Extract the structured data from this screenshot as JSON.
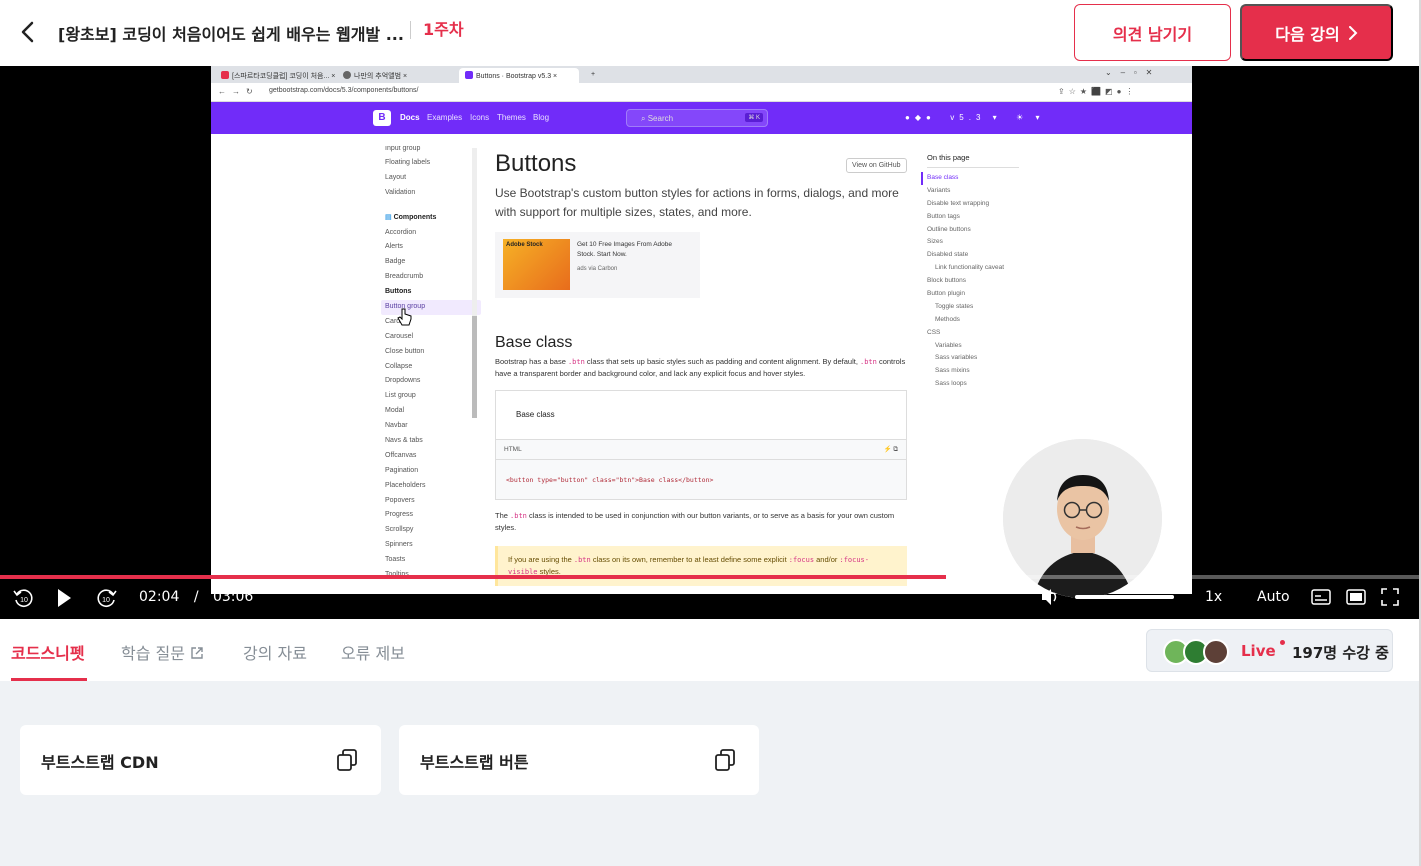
{
  "header": {
    "course_title": "[왕초보] 코딩이 처음이어도 쉽게 배우는 웹개발 ...",
    "week_label": "1주차",
    "opinion_button": "의견 남기기",
    "next_button": "다음 강의"
  },
  "video": {
    "browser_tabs": [
      "[스파르타코딩클럽] 코딩이 처음...",
      "나만의 추억앨범",
      "Buttons · Bootstrap v5.3"
    ],
    "url": "getbootstrap.com/docs/5.3/components/buttons/",
    "bs_nav": {
      "docs": "Docs",
      "examples": "Examples",
      "icons": "Icons",
      "themes": "Themes",
      "blog": "Blog",
      "search": "Search",
      "kbd": "⌘ K",
      "version": "v5.3"
    },
    "sidebar_items": [
      "Input group",
      "Floating labels",
      "Layout",
      "Validation"
    ],
    "sidebar_section": "Components",
    "component_items": [
      "Accordion",
      "Alerts",
      "Badge",
      "Breadcrumb",
      "Buttons",
      "Button group",
      "Card",
      "Carousel",
      "Close button",
      "Collapse",
      "Dropdowns",
      "List group",
      "Modal",
      "Navbar",
      "Navs & tabs",
      "Offcanvas",
      "Pagination",
      "Placeholders",
      "Popovers",
      "Progress",
      "Scrollspy",
      "Spinners",
      "Toasts",
      "Tooltips"
    ],
    "page_title": "Buttons",
    "lead": "Use Bootstrap's custom button styles for actions in forms, dialogs, and more with support for multiple sizes, states, and more.",
    "view_github": "View on GitHub",
    "ad_text": "Get 10 Free Images From Adobe Stock. Start Now.",
    "ad_brand": "Adobe Stock",
    "ad_via": "ads via Carbon",
    "section_title": "Base class",
    "base_p1": "Bootstrap has a base ",
    "base_code1": ".btn",
    "base_p2": " class that sets up basic styles such as padding and content alignment. By default, ",
    "base_code2": ".btn",
    "base_p3": " controls have a transparent border and background color, and lack any explicit focus and hover styles.",
    "example_label": "Base class",
    "html_label": "HTML",
    "code_snippet": "<button type=\"button\" class=\"btn\">Base class</button>",
    "intended_p1": "The ",
    "intended_code": ".btn",
    "intended_p2": " class is intended to be used in conjunction with our button variants, or to serve as a basis for your own custom styles.",
    "warn_p1": "If you are using the ",
    "warn_code1": ".btn",
    "warn_p2": " class on its own, remember to at least define some explicit ",
    "warn_code2": ":focus",
    "warn_p3": " and/or ",
    "warn_code3": ":focus-visible",
    "warn_p4": " styles.",
    "toc_title": "On this page",
    "toc_items": [
      "Base class",
      "Variants",
      "Disable text wrapping",
      "Button tags",
      "Outline buttons",
      "Sizes",
      "Disabled state",
      "Link functionality caveat",
      "Block buttons",
      "Button plugin",
      "Toggle states",
      "Methods",
      "CSS",
      "Variables",
      "Sass variables",
      "Sass mixins",
      "Sass loops"
    ]
  },
  "player": {
    "current_time": "02:04",
    "separator": "/",
    "total_time": "03:06",
    "progress_fraction": 0.666,
    "volume_fraction": 1.0,
    "speed": "1x",
    "quality": "Auto",
    "rewind_label": "10",
    "forward_label": "10"
  },
  "lecture_tabs": {
    "snippet": "코드스니펫",
    "qna": "학습 질문",
    "materials": "강의 자료",
    "report": "오류 제보"
  },
  "live": {
    "label": "Live",
    "count": "197명 수강 중"
  },
  "snippets": [
    {
      "title": "부트스트랩 CDN"
    },
    {
      "title": "부트스트랩 버튼"
    }
  ],
  "colors": {
    "accent": "#e52f4b",
    "bootstrap_purple": "#712cf9"
  }
}
